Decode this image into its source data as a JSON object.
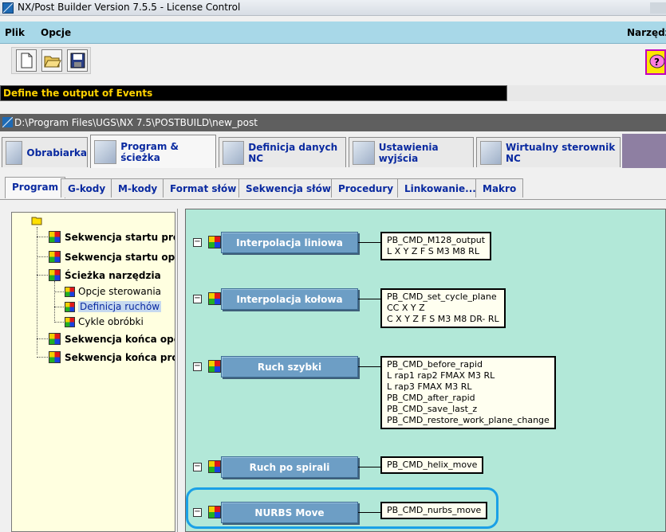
{
  "window": {
    "title": "NX/Post Builder Version 7.5.5 - License Control"
  },
  "menu": {
    "plik": "Plik",
    "opcje": "Opcje",
    "narzedzia": "Narzędzi"
  },
  "toolbar": {
    "icons": [
      "new-file-icon",
      "open-folder-icon",
      "save-icon"
    ]
  },
  "status": {
    "message": "Define the output of Events"
  },
  "path": {
    "text": "D:\\Program Files\\UGS\\NX 7.5\\POSTBUILD\\new_post"
  },
  "main_tabs": [
    {
      "label": "Obrabiarka"
    },
    {
      "label": "Program & ścieżka"
    },
    {
      "label": "Definicja danych NC"
    },
    {
      "label": "Ustawienia wyjścia"
    },
    {
      "label": "Wirtualny sterownik NC"
    }
  ],
  "sub_tabs": [
    {
      "label": "Program"
    },
    {
      "label": "G-kody"
    },
    {
      "label": "M-kody"
    },
    {
      "label": "Format słów"
    },
    {
      "label": "Sekwencja słów"
    },
    {
      "label": "Procedury"
    },
    {
      "label": "Linkowanie..."
    },
    {
      "label": "Makro"
    }
  ],
  "tree": [
    {
      "label": "Sekwencja startu programu"
    },
    {
      "label": "Sekwencja startu operacji"
    },
    {
      "label": "Ścieżka narzędzia"
    },
    {
      "label": "Opcje sterowania"
    },
    {
      "label": "Definicja ruchów"
    },
    {
      "label": "Cykle obróbki"
    },
    {
      "label": "Sekwencja końca operacji"
    },
    {
      "label": "Sekwencja końca programu"
    }
  ],
  "events": [
    {
      "label": "Interpolacja liniowa",
      "lines": [
        "PB_CMD_M128_output",
        "L X Y Z F S M3 M8 RL"
      ]
    },
    {
      "label": "Interpolacja kołowa",
      "lines": [
        "PB_CMD_set_cycle_plane",
        "CC X Y Z",
        "C X Y Z F S M3 M8 DR- RL"
      ]
    },
    {
      "label": "Ruch szybki",
      "lines": [
        "PB_CMD_before_rapid",
        "L rap1 rap2 FMAX M3 RL",
        "L rap3 FMAX M3 RL",
        "PB_CMD_after_rapid",
        "PB_CMD_save_last_z",
        "PB_CMD_restore_work_plane_change"
      ]
    },
    {
      "label": "Ruch po spirali",
      "lines": [
        "PB_CMD_helix_move"
      ]
    },
    {
      "label": "NURBS Move",
      "lines": [
        "PB_CMD_nurbs_move"
      ]
    }
  ]
}
